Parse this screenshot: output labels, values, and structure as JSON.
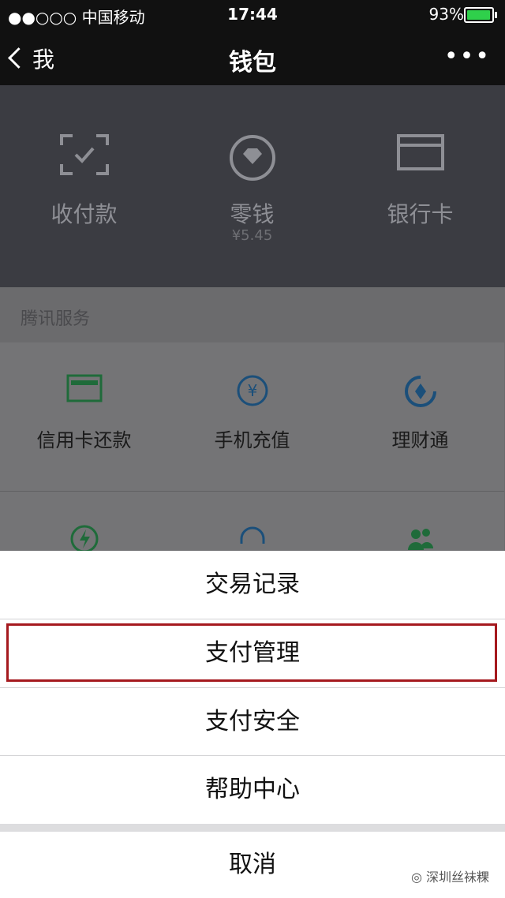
{
  "status_bar": {
    "carrier": "●●○○○ 中国移动",
    "time": "17:44",
    "battery": "93%"
  },
  "nav": {
    "back": "我",
    "title": "钱包",
    "more": "•••"
  },
  "wallet": {
    "items": [
      {
        "label": "收付款",
        "icon": "scan-qr-icon"
      },
      {
        "label": "零钱",
        "sub": "¥5.45",
        "icon": "wallet-diamond-icon"
      },
      {
        "label": "银行卡",
        "icon": "bank-card-icon"
      }
    ]
  },
  "services": {
    "title": "腾讯服务",
    "items": [
      {
        "label": "信用卡还款",
        "icon": "credit-card-icon"
      },
      {
        "label": "手机充值",
        "icon": "yen-recharge-icon"
      },
      {
        "label": "理财通",
        "icon": "wealth-icon"
      }
    ]
  },
  "sheet": {
    "items": [
      "交易记录",
      "支付管理",
      "支付安全",
      "帮助中心"
    ],
    "cancel": "取消"
  },
  "watermark": "深圳丝袜粿"
}
